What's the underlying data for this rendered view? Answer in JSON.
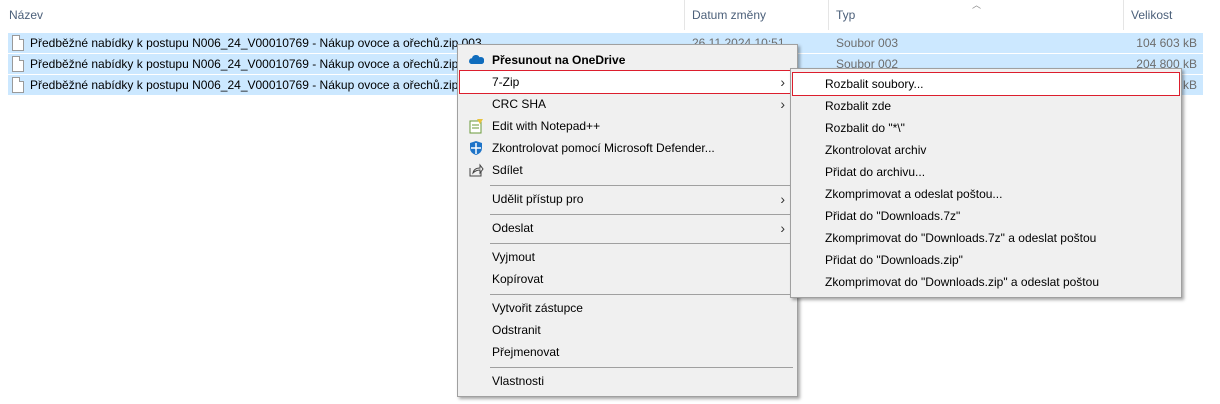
{
  "columns": {
    "name": "Název",
    "date": "Datum změny",
    "type": "Typ",
    "size": "Velikost"
  },
  "files": [
    {
      "name": "Předběžné nabídky k postupu N006_24_V00010769 - Nákup ovoce a ořechů.zip.003",
      "date": "26.11.2024 10:51",
      "type": "Soubor 003",
      "size": "104 603 kB"
    },
    {
      "name": "Předběžné nabídky k postupu N006_24_V00010769 - Nákup ovoce a ořechů.zip.002",
      "date": "",
      "type": "Soubor 002",
      "size": "204 800 kB"
    },
    {
      "name": "Předběžné nabídky k postupu N006_24_V00010769 - Nákup ovoce a ořechů.zip.001",
      "date": "",
      "type": "",
      "size": "kB"
    }
  ],
  "context_menu": {
    "onedrive": "Přesunout na OneDrive",
    "sevenzip": "7-Zip",
    "crc": "CRC SHA",
    "notepad": "Edit with Notepad++",
    "defender": "Zkontrolovat pomocí Microsoft Defender...",
    "share": "Sdílet",
    "grant_access": "Udělit přístup pro",
    "send_to": "Odeslat",
    "cut": "Vyjmout",
    "copy": "Kopírovat",
    "shortcut": "Vytvořit zástupce",
    "delete": "Odstranit",
    "rename": "Přejmenovat",
    "properties": "Vlastnosti"
  },
  "sevenzip_menu": [
    "Rozbalit soubory...",
    "Rozbalit zde",
    "Rozbalit do \"*\\\"",
    "Zkontrolovat archiv",
    "Přidat do archivu...",
    "Zkomprimovat a odeslat poštou...",
    "Přidat do \"Downloads.7z\"",
    "Zkomprimovat do \"Downloads.7z\" a odeslat poštou",
    "Přidat do \"Downloads.zip\"",
    "Zkomprimovat do \"Downloads.zip\" a odeslat poštou"
  ],
  "colors": {
    "selection": "#cce8ff",
    "menu_bg": "#f0f0f0",
    "highlight_border": "#dc1e2d"
  }
}
